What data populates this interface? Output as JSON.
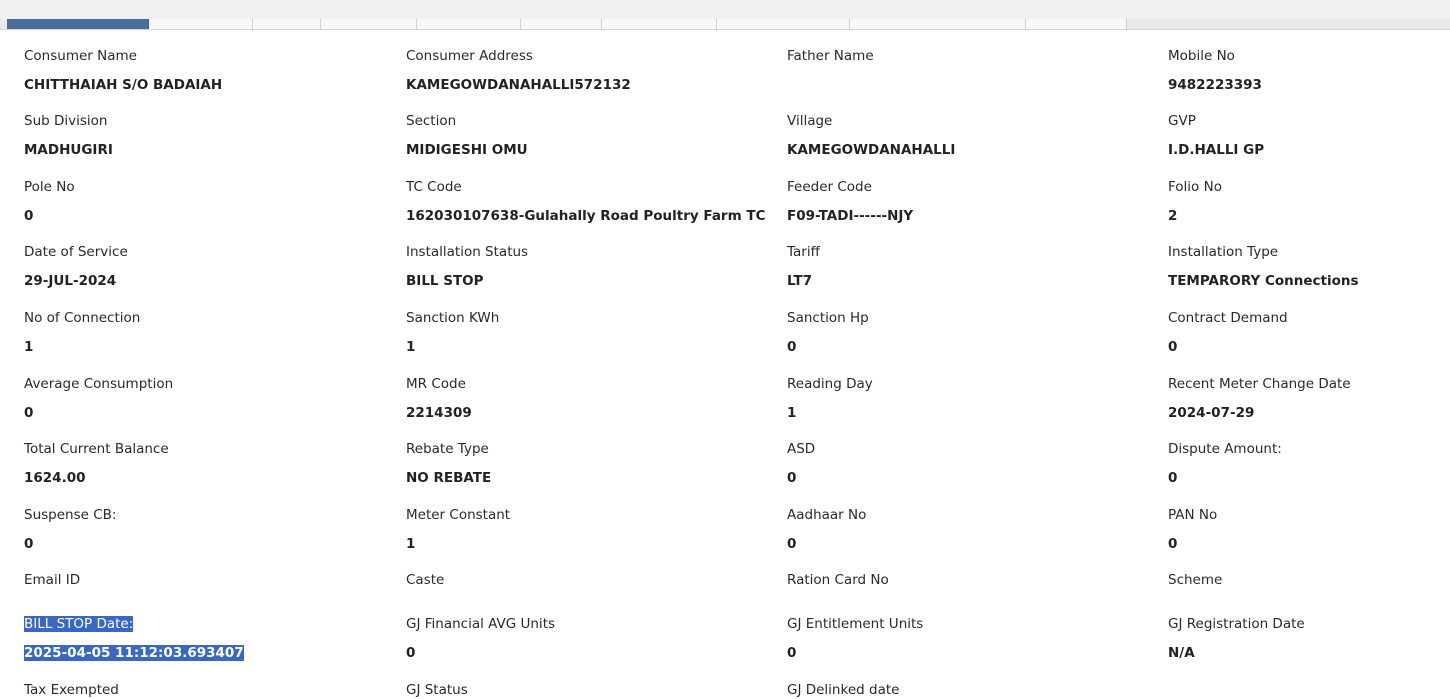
{
  "tabs": [
    {
      "label": ""
    },
    {
      "label": ""
    },
    {
      "label": ""
    },
    {
      "label": ""
    },
    {
      "label": ""
    },
    {
      "label": ""
    },
    {
      "label": ""
    },
    {
      "label": ""
    },
    {
      "label": ""
    },
    {
      "label": ""
    }
  ],
  "fields": {
    "consumer_name": {
      "label": "Consumer Name",
      "value": "CHITTHAIAH S/O BADAIAH"
    },
    "consumer_address": {
      "label": "Consumer Address",
      "value": "KAMEGOWDANAHALLI572132"
    },
    "father_name": {
      "label": "Father Name",
      "value": ""
    },
    "mobile_no": {
      "label": "Mobile No",
      "value": "9482223393"
    },
    "sub_division": {
      "label": "Sub Division",
      "value": "MADHUGIRI"
    },
    "section": {
      "label": "Section",
      "value": "MIDIGESHI OMU"
    },
    "village": {
      "label": "Village",
      "value": "KAMEGOWDANAHALLI"
    },
    "gvp": {
      "label": "GVP",
      "value": "I.D.HALLI GP"
    },
    "pole_no": {
      "label": "Pole No",
      "value": "0"
    },
    "tc_code": {
      "label": "TC Code",
      "value": "162030107638-Gulahally Road Poultry Farm TC"
    },
    "feeder_code": {
      "label": "Feeder Code",
      "value": "F09-TADI------NJY"
    },
    "folio_no": {
      "label": "Folio No",
      "value": "2"
    },
    "date_of_service": {
      "label": "Date of Service",
      "value": "29-JUL-2024"
    },
    "installation_status": {
      "label": "Installation Status",
      "value": "BILL STOP"
    },
    "tariff": {
      "label": "Tariff",
      "value": "LT7"
    },
    "installation_type": {
      "label": "Installation Type",
      "value": "TEMPARORY Connections"
    },
    "no_of_connection": {
      "label": "No of Connection",
      "value": "1"
    },
    "sanction_kwh": {
      "label": "Sanction KWh",
      "value": "1"
    },
    "sanction_hp": {
      "label": "Sanction Hp",
      "value": "0"
    },
    "contract_demand": {
      "label": "Contract Demand",
      "value": "0"
    },
    "average_consumption": {
      "label": "Average Consumption",
      "value": "0"
    },
    "mr_code": {
      "label": "MR Code",
      "value": "2214309"
    },
    "reading_day": {
      "label": "Reading Day",
      "value": "1"
    },
    "recent_meter_change_date": {
      "label": "Recent Meter Change Date",
      "value": "2024-07-29"
    },
    "total_current_balance": {
      "label": "Total Current Balance",
      "value": "1624.00"
    },
    "rebate_type": {
      "label": "Rebate Type",
      "value": "NO REBATE"
    },
    "asd": {
      "label": "ASD",
      "value": "0"
    },
    "dispute_amount": {
      "label": "Dispute Amount:",
      "value": "0"
    },
    "suspense_cb": {
      "label": "Suspense CB:",
      "value": "0"
    },
    "meter_constant": {
      "label": "Meter Constant",
      "value": "1"
    },
    "aadhaar_no": {
      "label": "Aadhaar No",
      "value": "0"
    },
    "pan_no": {
      "label": "PAN No",
      "value": "0"
    },
    "email_id": {
      "label": "Email ID",
      "value": ""
    },
    "caste": {
      "label": "Caste",
      "value": ""
    },
    "ration_card_no": {
      "label": "Ration Card No",
      "value": ""
    },
    "scheme": {
      "label": "Scheme",
      "value": ""
    },
    "bill_stop_date": {
      "label": "BILL STOP Date:",
      "value": "2025-04-05 11:12:03.693407"
    },
    "gj_financial_avg_units": {
      "label": "GJ Financial AVG Units",
      "value": "0"
    },
    "gj_entitlement_units": {
      "label": "GJ Entitlement Units",
      "value": "0"
    },
    "gj_registration_date": {
      "label": "GJ Registration Date",
      "value": "N/A"
    },
    "tax_exempted": {
      "label": "Tax Exempted",
      "value": ""
    },
    "gj_status": {
      "label": "GJ Status",
      "value": ""
    },
    "gj_delinked_date": {
      "label": "GJ Delinked date",
      "value": ""
    }
  },
  "colors": {
    "selection": "#3a66c4",
    "active_tab": "#4a6e9b"
  }
}
